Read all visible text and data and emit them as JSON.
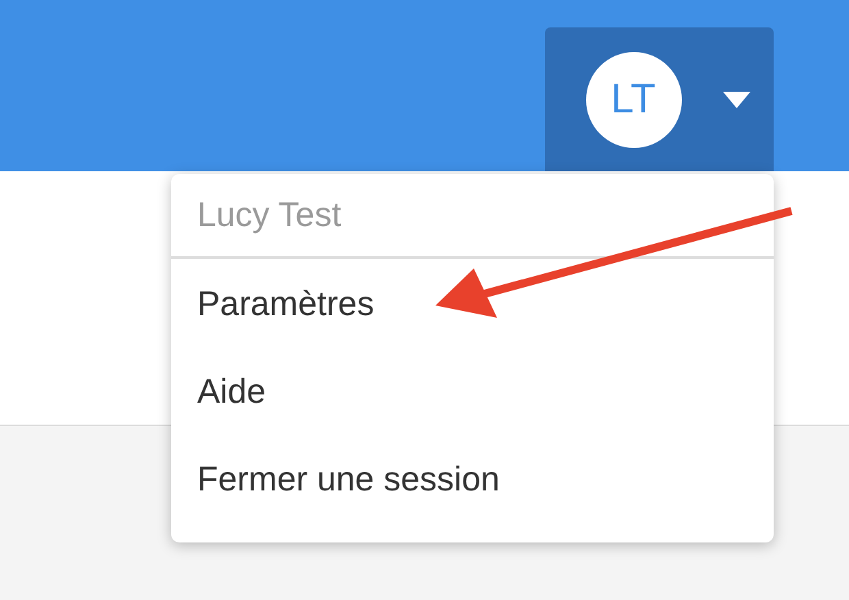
{
  "user_menu": {
    "initials": "LT",
    "expanded": true
  },
  "dropdown": {
    "header": "Lucy Test",
    "items": [
      {
        "label": "Paramètres"
      },
      {
        "label": "Aide"
      },
      {
        "label": "Fermer une session"
      }
    ]
  }
}
